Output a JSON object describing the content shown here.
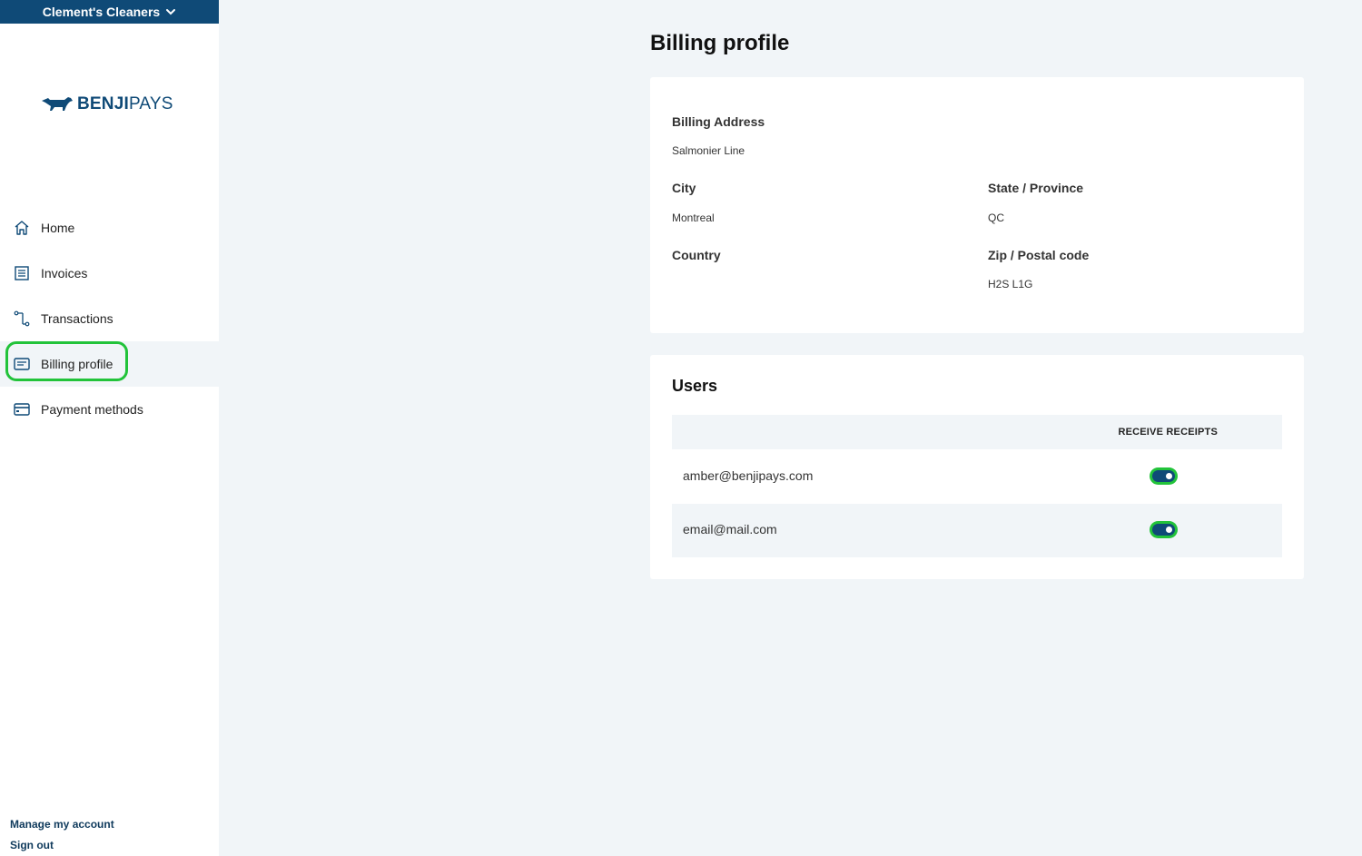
{
  "account": {
    "name": "Clement's Cleaners"
  },
  "brand": {
    "name_bold": "BENJI",
    "name_light": "PAYS",
    "color": "#0f4a77"
  },
  "sidebar": {
    "items": [
      {
        "label": "Home",
        "icon": "home-icon"
      },
      {
        "label": "Invoices",
        "icon": "invoice-icon"
      },
      {
        "label": "Transactions",
        "icon": "transactions-icon"
      },
      {
        "label": "Billing profile",
        "icon": "billing-icon",
        "active": true
      },
      {
        "label": "Payment methods",
        "icon": "card-icon"
      }
    ],
    "footer": {
      "manage": "Manage my account",
      "signout": "Sign out"
    }
  },
  "page": {
    "title": "Billing profile"
  },
  "billing": {
    "address_label": "Billing Address",
    "address_value": "Salmonier Line",
    "city_label": "City",
    "city_value": "Montreal",
    "state_label": "State / Province",
    "state_value": "QC",
    "country_label": "Country",
    "country_value": "",
    "zip_label": "Zip / Postal code",
    "zip_value": "H2S L1G"
  },
  "users": {
    "title": "Users",
    "column_receipts": "RECEIVE RECEIPTS",
    "rows": [
      {
        "email": "amber@benjipays.com",
        "receive_receipts": true
      },
      {
        "email": "email@mail.com",
        "receive_receipts": true
      }
    ]
  },
  "colors": {
    "accent": "#22c33a",
    "primary": "#0f4a77",
    "background": "#f1f5f8"
  }
}
